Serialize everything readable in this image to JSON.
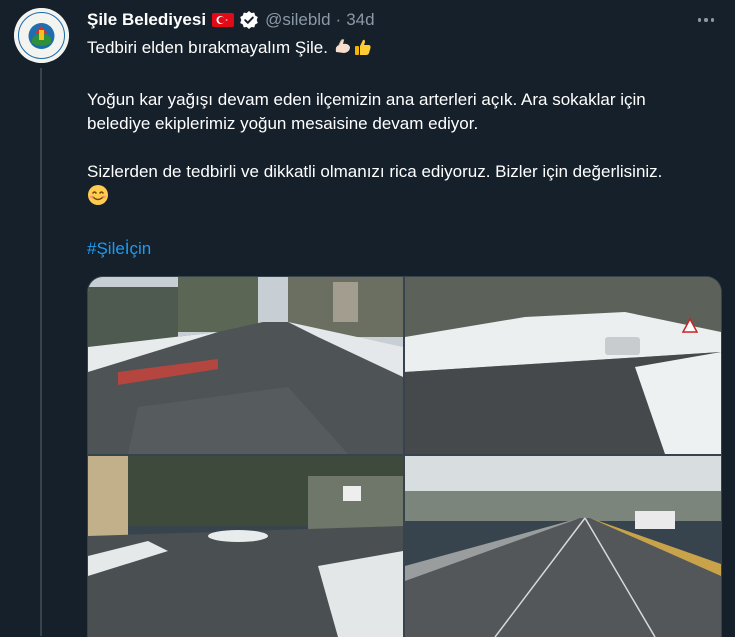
{
  "author": {
    "name": "Şile Belediyesi",
    "handle": "@silebld",
    "separator": "·",
    "time": "34d",
    "flag_icon": "turkey-flag-icon",
    "verified_icon": "verified-badge-icon"
  },
  "tweet": {
    "line1": "Tedbiri elden bırakmayalım Şile.",
    "line1_emojis": [
      "flexed-biceps-icon",
      "thumbs-up-icon"
    ],
    "para2_line1": "Yoğun kar yağışı devam eden ilçemizin ana arterleri açık. Ara sokaklar için",
    "para2_line2": "belediye ekiplerimiz yoğun mesaisine devam ediyor.",
    "para3_line1": "Sizlerden de tedbirli ve dikkatli olmanızı rica ediyoruz. Bizler için değerlisiniz.",
    "para3_emoji": "smiling-face-icon",
    "hashtag": "#Şileİçin"
  },
  "media": {
    "photos": [
      {
        "label": "snowy-road-with-crosswalk-photo"
      },
      {
        "label": "snowy-curved-road-with-car-photo"
      },
      {
        "label": "snowy-intersection-photo"
      },
      {
        "label": "snowy-bridge-road-photo"
      }
    ]
  },
  "colors": {
    "background": "#15202b",
    "text": "#ffffff",
    "secondary": "#8b98a5",
    "link": "#1d9bf0",
    "verified": "#1d9bf0"
  }
}
